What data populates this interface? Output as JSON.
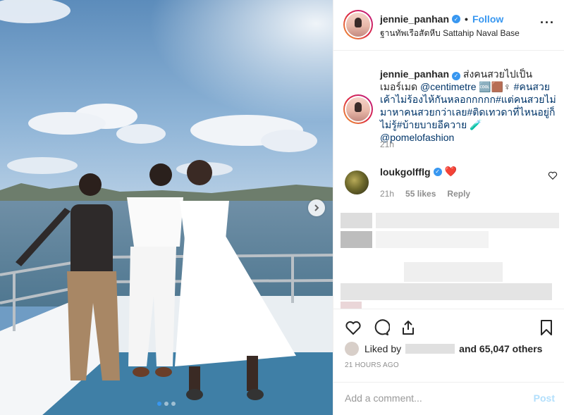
{
  "header": {
    "username": "jennie_panhan",
    "follow_label": "Follow",
    "bullet": "•",
    "location": "ฐานทัพเรือสัตหีบ Sattahip Naval Base",
    "more_label": "···"
  },
  "caption": {
    "username": "jennie_panhan",
    "text_1": "ส่งคนสวยไปเป็นเมอร์เมด",
    "mention_1": "@centimetre",
    "emoji": "🆒🟫♀",
    "hashtag_1": "#คนสวยเค้าไม่ร้องไห้กันหลอกกกกก#แต่คนสวยไม่มาหาคนสวยกว่าเลย#ติดเทวดาที่ไหนอยู่ก็ไม่รู้#บ้ายบายอีควาย",
    "flask": "🧪",
    "mention_2": "@pomelofashion",
    "time": "21h"
  },
  "comment": {
    "username": "loukgolfflg",
    "text": "❤️",
    "time": "21h",
    "likes": "55 likes",
    "reply": "Reply"
  },
  "likes": {
    "prefix": "Liked by",
    "suffix": "and 65,047 others"
  },
  "timestamp": "21 HOURS AGO",
  "add_comment": {
    "placeholder": "Add a comment...",
    "post_label": "Post"
  },
  "icons": {
    "verified": "verified-badge-icon",
    "heart": "heart-icon",
    "comment": "comment-icon",
    "share": "share-icon",
    "bookmark": "bookmark-icon",
    "next": "chevron-right-icon"
  },
  "colors": {
    "link": "#003569",
    "accent": "#3897f0",
    "muted": "#8e8e8e",
    "post_disabled": "#b2dffc"
  },
  "carousel": {
    "total": 3,
    "active": 1
  }
}
